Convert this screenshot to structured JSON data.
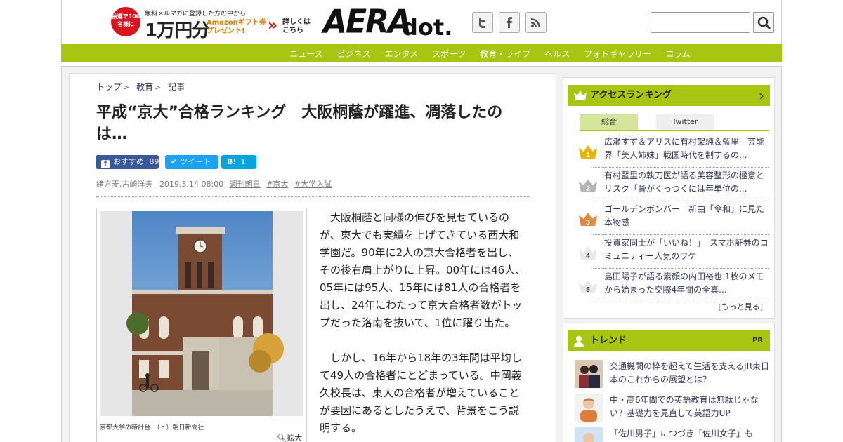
{
  "header": {
    "promo": {
      "badge": "抽選で100名様に",
      "line1": "無料メルマガに登録した方の中から",
      "big": "1万円分",
      "gift_line1": "Amazonギフト券",
      "gift_line2": "プレゼント!",
      "more_line1": "詳しくは",
      "more_line2": "こちら"
    },
    "logo_main": "AERA",
    "logo_sub": "dot.",
    "social": {
      "twitter": "t",
      "facebook": "f",
      "rss": "rss-icon"
    },
    "search": {
      "value": "",
      "placeholder": ""
    },
    "brand_color": "#a8c512"
  },
  "nav": {
    "items": [
      "ニュース",
      "ビジネス",
      "エンタメ",
      "スポーツ",
      "教育・ライフ",
      "ヘルス",
      "フォトギャラリー",
      "コラム"
    ]
  },
  "article": {
    "breadcrumb": [
      "トップ",
      "教育",
      "記事"
    ],
    "headline": "平成“京大”合格ランキング　大阪桐蔭が躍進、凋落したのは…",
    "share": {
      "facebook_label": "おすすめ",
      "facebook_count": "89",
      "twitter_label": "ツイート",
      "hatena_label": "B!",
      "hatena_count": "1"
    },
    "meta": {
      "authors": "緒方麦,古崎洋夫",
      "date": "2019.3.14 08:00",
      "source": "週刊朝日",
      "tags": [
        "#京大",
        "#大学入試"
      ]
    },
    "figure": {
      "caption": "京都大学の時計台　（ｃ）朝日新聞社",
      "zoom_label": "拡大"
    },
    "paragraphs": [
      "大阪桐蔭と同様の伸びを見せているのが、東大でも実績を上げてきている西大和学園だ。90年に2人の京大合格者を出し、その後右肩上がりに上昇。00年には46人、05年には95人、15年には81人の合格者を出し、24年にわたって京大合格者数がトップだった洛南を抜いて、1位に躍り出た。",
      "しかし、16年から18年の3年間は平均して49人の合格者にとどまっている。中岡義久校長は、東大の合格者が増えていることが要因にあるとしたうえで、背景をこう説明する。"
    ]
  },
  "sidebar": {
    "ranking": {
      "title": "アクセスランキング",
      "tabs": [
        "総合",
        "Twitter"
      ],
      "items": [
        {
          "rank": "1",
          "text": "広瀬すず＆アリスに有村架純＆藍里　芸能界「美人姉妹」戦国時代を制するの...",
          "color": "#e8b40c"
        },
        {
          "rank": "2",
          "text": "有村藍里の執刀医が語る美容整形の極意とリスク「骨がくっつくには年単位の...",
          "color": "#b5b5b5"
        },
        {
          "rank": "3",
          "text": "ゴールデンボンバー　新曲「令和」に見た本物感",
          "color": "#e28a3c"
        },
        {
          "rank": "4",
          "text": "投資家同士が「いいね！」　スマホ証券のコミュニティー人気のワケ",
          "color": "#e9e9e9"
        },
        {
          "rank": "5",
          "text": "島田陽子が語る素顔の内田裕也 1枚のメモから始まった交際4年間の全真...",
          "color": "#e9e9e9"
        }
      ],
      "more": "[もっと見る]"
    },
    "trend": {
      "title": "トレンド",
      "pr": "PR",
      "items": [
        {
          "text": "交通機関の枠を超えて生活を支えるJR東日本のこれからの展望とは？"
        },
        {
          "text": "中・高6年間での英語教育は無駄じゃない？基礎力を見直して英語力UP"
        },
        {
          "text": "「佐川男子」につづき「佐川女子」も"
        }
      ]
    }
  }
}
